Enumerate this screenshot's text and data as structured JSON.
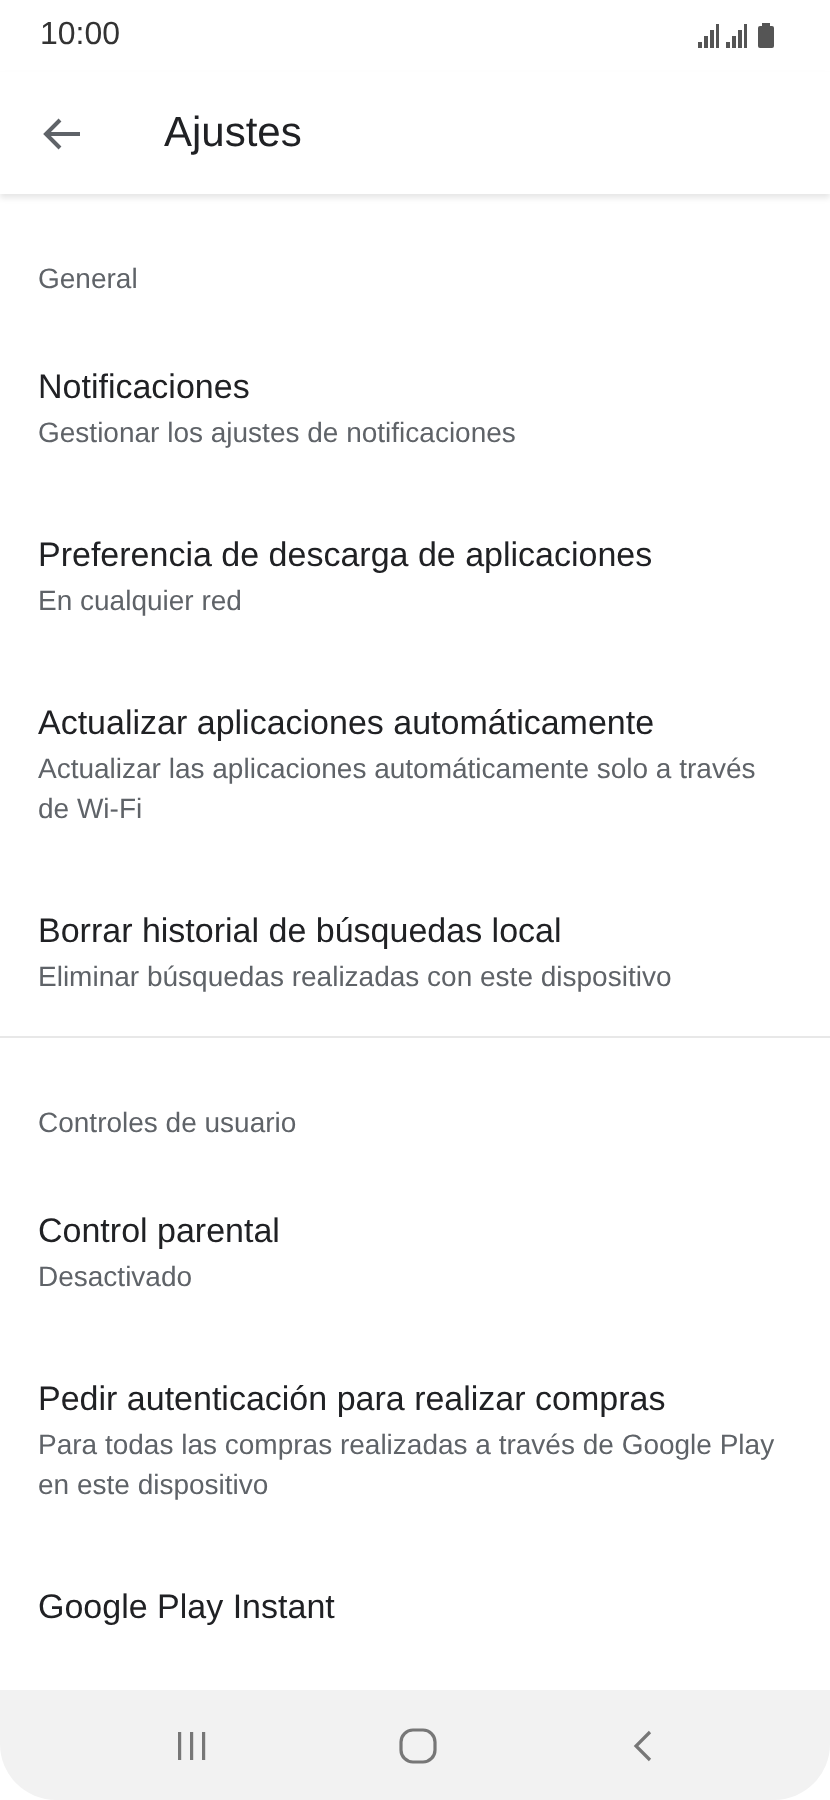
{
  "status_bar": {
    "time": "10:00"
  },
  "header": {
    "title": "Ajustes"
  },
  "sections": [
    {
      "label": "General",
      "items": [
        {
          "title": "Notificaciones",
          "subtitle": "Gestionar los ajustes de notificaciones"
        },
        {
          "title": "Preferencia de descarga de aplicaciones",
          "subtitle": "En cualquier red"
        },
        {
          "title": "Actualizar aplicaciones automáticamente",
          "subtitle": "Actualizar las aplicaciones automáticamente solo a través de Wi-Fi"
        },
        {
          "title": "Borrar historial de búsquedas local",
          "subtitle": "Eliminar búsquedas realizadas con este dispositivo"
        }
      ]
    },
    {
      "label": "Controles de usuario",
      "items": [
        {
          "title": "Control parental",
          "subtitle": "Desactivado"
        },
        {
          "title": "Pedir autenticación para realizar compras",
          "subtitle": "Para todas las compras realizadas a través de Google Play en este dispositivo"
        },
        {
          "title": "Google Play Instant"
        }
      ]
    }
  ]
}
